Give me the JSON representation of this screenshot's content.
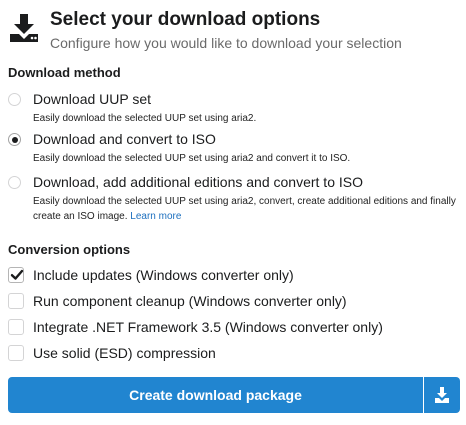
{
  "header": {
    "icon": "download-icon",
    "title": "Select your download options",
    "subtitle": "Configure how you would like to download your selection"
  },
  "download_method": {
    "heading": "Download method",
    "options": [
      {
        "label": "Download UUP set",
        "description": "Easily download the selected UUP set using aria2.",
        "checked": false
      },
      {
        "label": "Download and convert to ISO",
        "description": "Easily download the selected UUP set using aria2 and convert it to ISO.",
        "checked": true
      },
      {
        "label": "Download, add additional editions and convert to ISO",
        "description": "Easily download the selected UUP set using aria2, convert, create additional editions and finally create an ISO image.",
        "link_text": "Learn more",
        "checked": false
      }
    ]
  },
  "conversion_options": {
    "heading": "Conversion options",
    "items": [
      {
        "label": "Include updates (Windows converter only)",
        "checked": true
      },
      {
        "label": "Run component cleanup (Windows converter only)",
        "checked": false
      },
      {
        "label": "Integrate .NET Framework 3.5 (Windows converter only)",
        "checked": false
      },
      {
        "label": "Use solid (ESD) compression",
        "checked": false
      }
    ]
  },
  "actions": {
    "create_label": "Create download package",
    "download_icon": "download-icon"
  },
  "colors": {
    "primary": "#2185d0",
    "link": "#1e70bf"
  }
}
